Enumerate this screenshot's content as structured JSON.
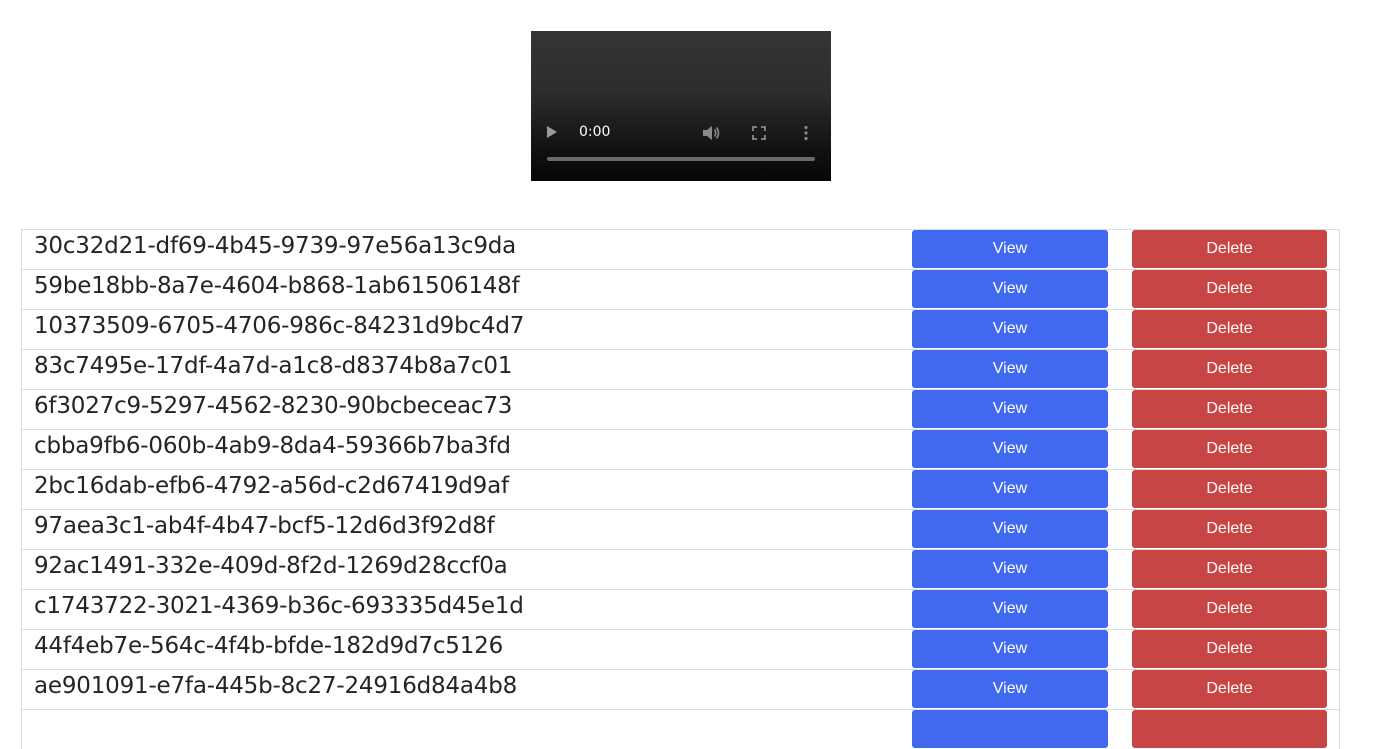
{
  "video": {
    "time": "0:00"
  },
  "buttons": {
    "view_label": "View",
    "delete_label": "Delete"
  },
  "items": [
    {
      "id": "30c32d21-df69-4b45-9739-97e56a13c9da"
    },
    {
      "id": "59be18bb-8a7e-4604-b868-1ab61506148f"
    },
    {
      "id": "10373509-6705-4706-986c-84231d9bc4d7"
    },
    {
      "id": "83c7495e-17df-4a7d-a1c8-d8374b8a7c01"
    },
    {
      "id": "6f3027c9-5297-4562-8230-90bcbeceac73"
    },
    {
      "id": "cbba9fb6-060b-4ab9-8da4-59366b7ba3fd"
    },
    {
      "id": "2bc16dab-efb6-4792-a56d-c2d67419d9af"
    },
    {
      "id": "97aea3c1-ab4f-4b47-bcf5-12d6d3f92d8f"
    },
    {
      "id": "92ac1491-332e-409d-8f2d-1269d28ccf0a"
    },
    {
      "id": "c1743722-3021-4369-b36c-693335d45e1d"
    },
    {
      "id": "44f4eb7e-564c-4f4b-bfde-182d9d7c5126"
    },
    {
      "id": "ae901091-e7fa-445b-8c27-24916d84a4b8"
    },
    {
      "id": ""
    }
  ]
}
